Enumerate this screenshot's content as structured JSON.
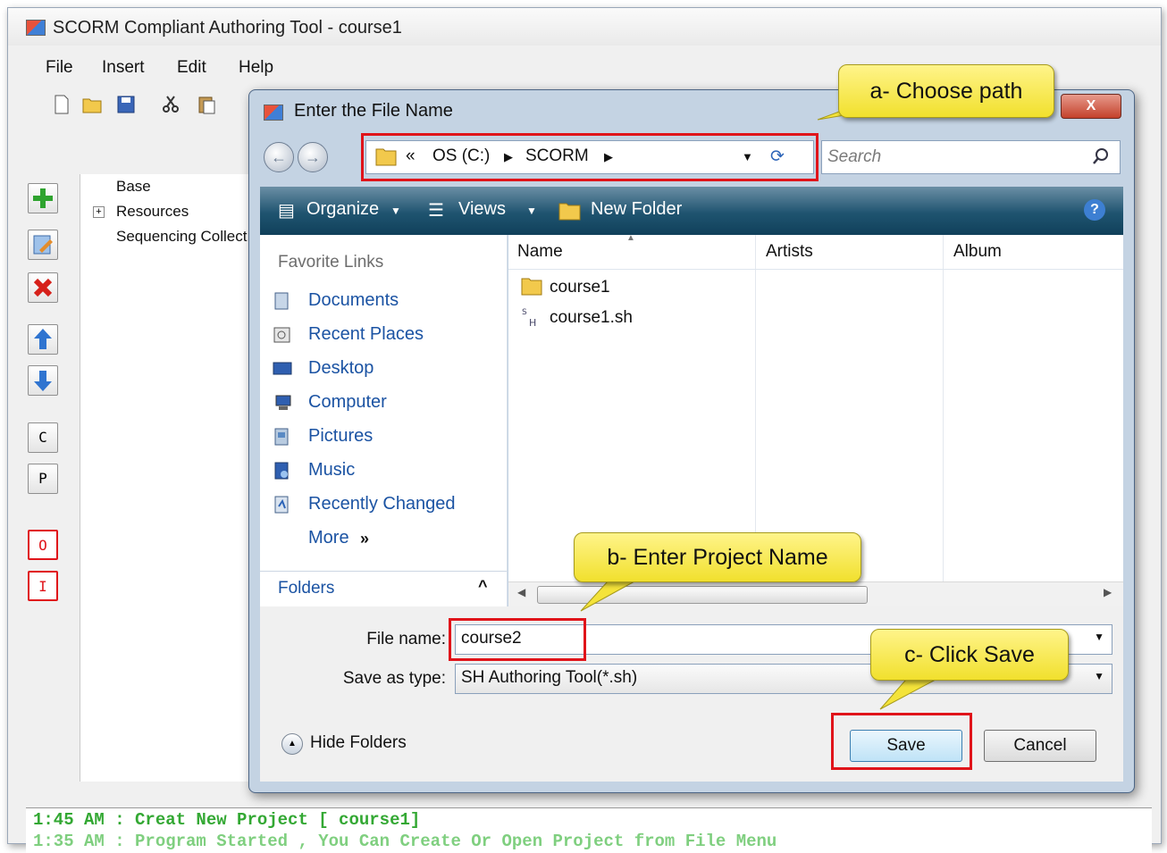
{
  "app": {
    "title": "SCORM Compliant Authoring Tool - course1",
    "menu": [
      "File",
      "Insert",
      "Edit",
      "Help"
    ],
    "tree": [
      "Base",
      "Resources",
      "Sequencing Collect"
    ],
    "side_buttons": [
      "C",
      "P",
      "O",
      "I"
    ],
    "log": [
      "1:45 AM  :  Creat New Project [ course1]",
      "1:35 AM  :  Program Started  ,  You Can Create Or Open Project from File Menu"
    ]
  },
  "dialog": {
    "title": "Enter the File Name",
    "close_label": "X",
    "address": {
      "prefix": "«",
      "segments": [
        "OS (C:)",
        "SCORM"
      ]
    },
    "search_placeholder": "Search",
    "toolbar": {
      "organize": "Organize",
      "views": "Views",
      "new_folder": "New Folder",
      "help": "?"
    },
    "favorite_links_heading": "Favorite Links",
    "favorites": [
      "Documents",
      "Recent Places",
      "Desktop",
      "Computer",
      "Pictures",
      "Music",
      "Recently Changed"
    ],
    "more": "More",
    "folders_label": "Folders",
    "columns": [
      "Name",
      "Artists",
      "Album"
    ],
    "files": [
      "course1",
      "course1.sh"
    ],
    "file_name_label": "File name:",
    "file_name_value": "course2",
    "save_as_label": "Save as type:",
    "save_as_value": "SH Authoring Tool(*.sh)",
    "hide_folders": "Hide Folders",
    "save_button": "Save",
    "cancel_button": "Cancel"
  },
  "callouts": {
    "a": "a- Choose path",
    "b": "b- Enter Project Name",
    "c": "c- Click Save"
  },
  "colors": {
    "highlight": "#e0141a",
    "callout": "#f7ea4c",
    "log_text": "#33a833",
    "link": "#1b53a3"
  }
}
